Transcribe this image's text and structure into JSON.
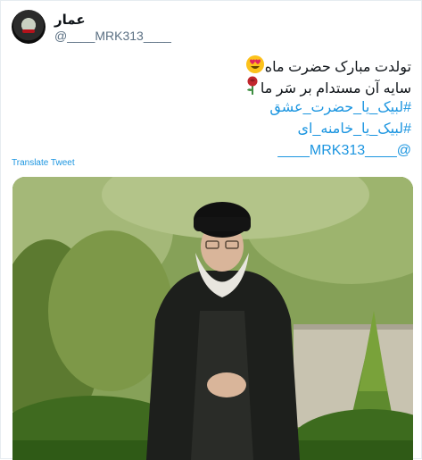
{
  "author": {
    "name": "عمار",
    "handle": "@____MRK313____"
  },
  "tweet": {
    "line1": "تولدت مبارک حضرت ماه",
    "line2": "سایه آن مستدام بر سَر ما",
    "hashtag1": "#لبیک_یا_حضرت_عشق",
    "hashtag2": "#لبیک_یا_خامنه_ای",
    "mention": "@____MRK313____"
  },
  "emojis": {
    "line1": "heart-eyes-emoji",
    "line2": "rose-emoji"
  },
  "translate_label": "Translate Tweet",
  "colors": {
    "link": "#1b95e0",
    "handle": "#5b7083",
    "text": "#0f1419"
  }
}
